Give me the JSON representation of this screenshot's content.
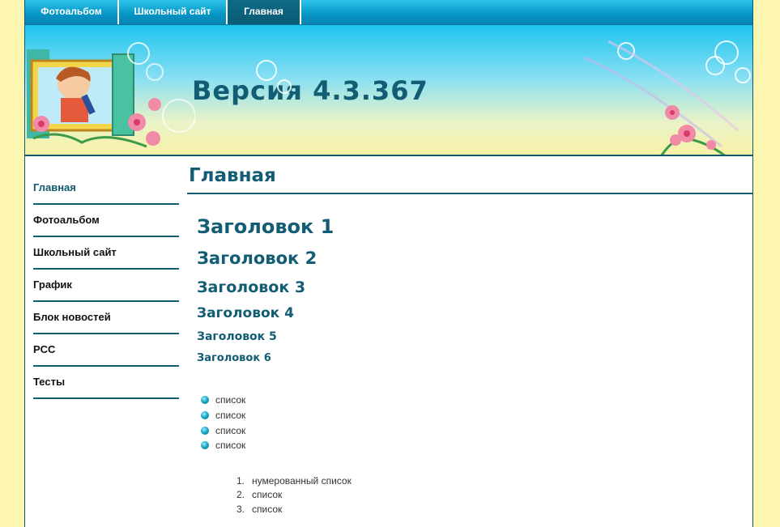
{
  "nav": {
    "tabs": [
      {
        "label": "Фотоальбом"
      },
      {
        "label": "Школьный сайт"
      },
      {
        "label": "Главная"
      }
    ]
  },
  "banner": {
    "title": "Версия 4.3.367"
  },
  "sidebar": {
    "items": [
      {
        "label": "Главная"
      },
      {
        "label": "Фотоальбом"
      },
      {
        "label": "Школьный сайт"
      },
      {
        "label": "График"
      },
      {
        "label": "Блок новостей"
      },
      {
        "label": "PCC"
      },
      {
        "label": "Тесты"
      }
    ]
  },
  "main": {
    "title": "Главная",
    "headings": [
      "Заголовок 1",
      "Заголовок 2",
      "Заголовок 3",
      "Заголовок 4",
      "Заголовок 5",
      "Заголовок 6"
    ],
    "bullet_list": [
      "список",
      "список",
      "список",
      "список"
    ],
    "numbered_list": [
      {
        "num": "1.",
        "text": "нумерованный список"
      },
      {
        "num": "2.",
        "text": "список"
      },
      {
        "num": "3.",
        "text": "список"
      }
    ]
  },
  "colors": {
    "accent": "#125d73",
    "nav": "#0694c4",
    "page_bg": "#fdf6b0"
  }
}
